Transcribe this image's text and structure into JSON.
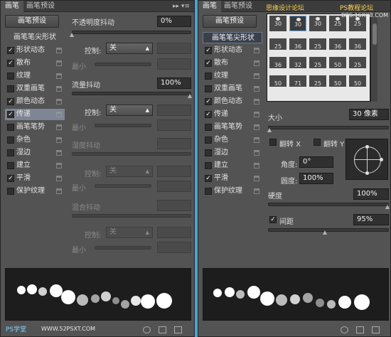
{
  "left": {
    "tabs": [
      "画笔",
      "画笔预设"
    ],
    "tab_controls": "▸▸ ▾≡",
    "preset_button": "画笔预设",
    "list": [
      {
        "label": "画笔笔尖形状",
        "type": "header"
      },
      {
        "label": "形状动态",
        "checked": true
      },
      {
        "label": "散布",
        "checked": true
      },
      {
        "label": "纹理",
        "checked": false
      },
      {
        "label": "双重画笔",
        "checked": false
      },
      {
        "label": "颜色动态",
        "checked": true
      },
      {
        "label": "传递",
        "checked": true,
        "selected": true
      },
      {
        "label": "画笔笔势",
        "checked": false
      },
      {
        "label": "杂色",
        "checked": false
      },
      {
        "label": "湿边",
        "checked": false
      },
      {
        "label": "建立",
        "checked": false
      },
      {
        "label": "平滑",
        "checked": true
      },
      {
        "label": "保护纹理",
        "checked": false
      }
    ],
    "opacity_jitter": {
      "label": "不透明度抖动",
      "value": "0%",
      "control_label": "控制:",
      "control_value": "关",
      "min_label": "最小"
    },
    "flow_jitter": {
      "label": "流量抖动",
      "value": "100%",
      "control_label": "控制:",
      "control_value": "关",
      "min_label": "最小"
    },
    "wetness_jitter": {
      "label": "湿度抖动",
      "control_label": "控制:",
      "control_value": "关",
      "min_label": "最小"
    },
    "mix_jitter": {
      "label": "混合抖动",
      "control_label": "控制:",
      "control_value": "关",
      "min_label": "最小"
    }
  },
  "right": {
    "tabs": [
      "画笔",
      "画笔预设"
    ],
    "preset_button": "画笔预设",
    "list": [
      {
        "label": "画笔笔尖形状",
        "type": "header",
        "selected": true
      },
      {
        "label": "形状动态",
        "checked": true
      },
      {
        "label": "散布",
        "checked": true
      },
      {
        "label": "纹理",
        "checked": false
      },
      {
        "label": "双重画笔",
        "checked": false
      },
      {
        "label": "颜色动态",
        "checked": true
      },
      {
        "label": "传递",
        "checked": true
      },
      {
        "label": "画笔笔势",
        "checked": false
      },
      {
        "label": "杂色",
        "checked": false
      },
      {
        "label": "湿边",
        "checked": false
      },
      {
        "label": "建立",
        "checked": false
      },
      {
        "label": "平滑",
        "checked": true
      },
      {
        "label": "保护纹理",
        "checked": false
      }
    ],
    "brush_sizes": [
      [
        "30",
        "30",
        "30",
        "25",
        "25"
      ],
      [
        "25",
        "36",
        "25",
        "36",
        "36"
      ],
      [
        "36",
        "32",
        "25",
        "50",
        "25"
      ],
      [
        "50",
        "71",
        "25",
        "50",
        "50"
      ]
    ],
    "size": {
      "label": "大小",
      "value": "30 像素"
    },
    "flip_x": "翻转 X",
    "flip_y": "翻转 Y",
    "angle": {
      "label": "角度:",
      "value": "0°"
    },
    "roundness": {
      "label": "圆度:",
      "value": "100%"
    },
    "hardness": {
      "label": "硬度",
      "value": "100%"
    },
    "spacing": {
      "label": "间距",
      "value": "95%",
      "checked": true
    }
  },
  "watermarks": {
    "site_top": "思缘设计论坛",
    "site_top2": "PS教程论坛",
    "url_top": "BBS.16XX8.COM",
    "ps_logo": "PS学堂",
    "url_bottom": "WWW.52PSXT.COM"
  }
}
